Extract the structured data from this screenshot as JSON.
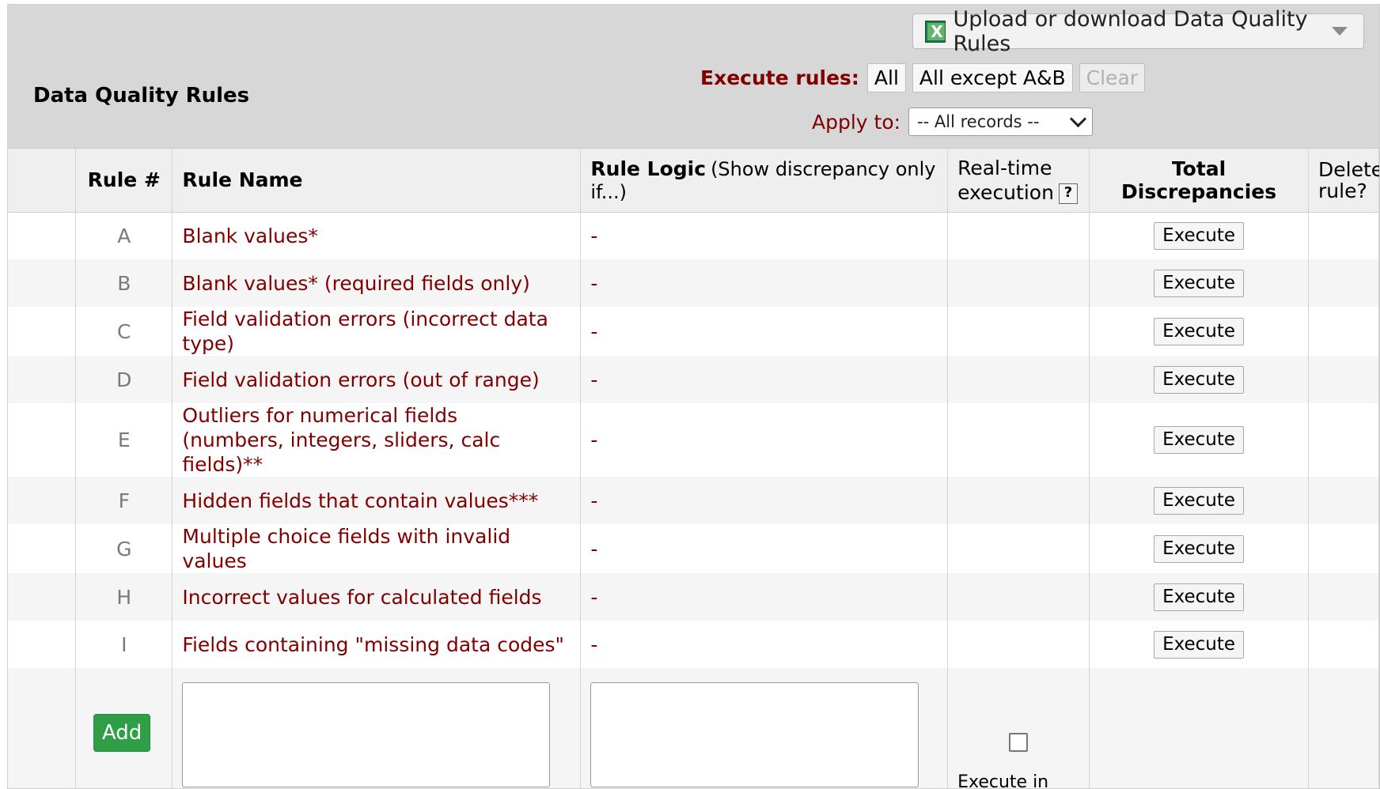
{
  "panel": {
    "title": "Data Quality Rules",
    "upload_label": "Upload or download Data Quality Rules",
    "execute_label": "Execute rules:",
    "execute_buttons": [
      "All",
      "All except A&B",
      "Clear"
    ],
    "apply_label": "Apply to:",
    "apply_selected": "-- All records --"
  },
  "table": {
    "headers": {
      "rule_num": "Rule #",
      "rule_name": "Rule Name",
      "rule_logic": "Rule Logic",
      "rule_logic_sub": "(Show discrepancy only if...)",
      "realtime_1": "Real-time",
      "realtime_2": "execution",
      "help": "?",
      "total": "Total Discrepancies",
      "delete_1": "Delete",
      "delete_2": "rule?"
    },
    "rows": [
      {
        "letter": "A",
        "name": "Blank values*",
        "logic": "-",
        "button": "Execute"
      },
      {
        "letter": "B",
        "name": "Blank values* (required fields only)",
        "logic": "-",
        "button": "Execute"
      },
      {
        "letter": "C",
        "name": "Field validation errors (incorrect data type)",
        "logic": "-",
        "button": "Execute"
      },
      {
        "letter": "D",
        "name": "Field validation errors (out of range)",
        "logic": "-",
        "button": "Execute"
      },
      {
        "letter": "E",
        "name_line1": "Outliers for numerical fields",
        "name_line2": "(numbers, integers, sliders, calc fields)**",
        "logic": "-",
        "button": "Execute"
      },
      {
        "letter": "F",
        "name": "Hidden fields that contain values***",
        "logic": "-",
        "button": "Execute"
      },
      {
        "letter": "G",
        "name": "Multiple choice fields with invalid values",
        "logic": "-",
        "button": "Execute"
      },
      {
        "letter": "H",
        "name": "Incorrect values for calculated fields",
        "logic": "-",
        "button": "Execute"
      },
      {
        "letter": "I",
        "name": "Fields containing \"missing data codes\"",
        "logic": "-",
        "button": "Execute"
      }
    ],
    "add_row": {
      "add_label": "Add",
      "execute_in_label": "Execute in"
    }
  },
  "colors": {
    "header_bg": "#d7d7d7",
    "rule_text": "#800000",
    "add_button": "#2e9e47"
  },
  "icons": [
    "excel-icon",
    "caret-down-icon",
    "select-chevron-icon",
    "help-icon",
    "checkbox"
  ]
}
